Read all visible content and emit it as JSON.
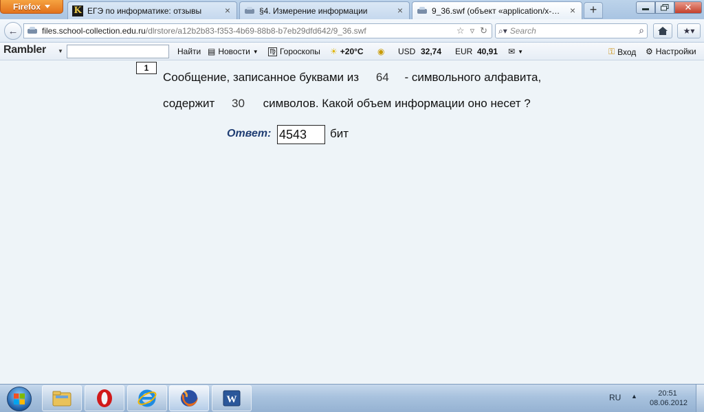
{
  "browser": {
    "menu_label": "Firefox",
    "tabs": [
      {
        "title": "ЕГЭ по информатике: отзывы",
        "icon": "k-favicon"
      },
      {
        "title": "§4. Измерение информации",
        "icon": "page-favicon"
      },
      {
        "title": "9_36.swf (объект «application/x-shoc...",
        "icon": "page-favicon",
        "active": true
      }
    ],
    "newtab_label": "+",
    "url_host": "files.school-collection.edu.ru",
    "url_path": "/dlrstore/a12b2b83-f353-4b69-88b8-b7eb29dfd642/9_36.swf",
    "search_placeholder": "Search"
  },
  "rambler_bar": {
    "logo": "Rambler",
    "find_label": "Найти",
    "news_label": "Новости",
    "horoscope_label": "Гороскопы",
    "temperature": "+20°C",
    "usd_label": "USD",
    "usd_value": "32,74",
    "eur_label": "EUR",
    "eur_value": "40,91",
    "login_label": "Вход",
    "settings_label": "Настройки"
  },
  "task": {
    "number": "1",
    "line1_part1": "Сообщение,  записанное буквами из",
    "alphabet_size": "64",
    "line1_part2": "- символьного алфавита,",
    "line2_part1": "содержит",
    "symbol_count": "30",
    "line2_part2": "символов.  Какой объем информации оно несет ?",
    "answer_label": "Ответ:",
    "answer_value": "4543",
    "answer_unit": "бит"
  },
  "taskbar": {
    "apps": [
      "explorer",
      "opera",
      "internet-explorer",
      "firefox",
      "word"
    ],
    "active_app": "firefox",
    "language": "RU",
    "time": "20:51",
    "date": "08.06.2012"
  },
  "colors": {
    "content_bg": "#eef4f8",
    "answer_label": "#1f3d73",
    "firefox_button": "#e2721c"
  }
}
